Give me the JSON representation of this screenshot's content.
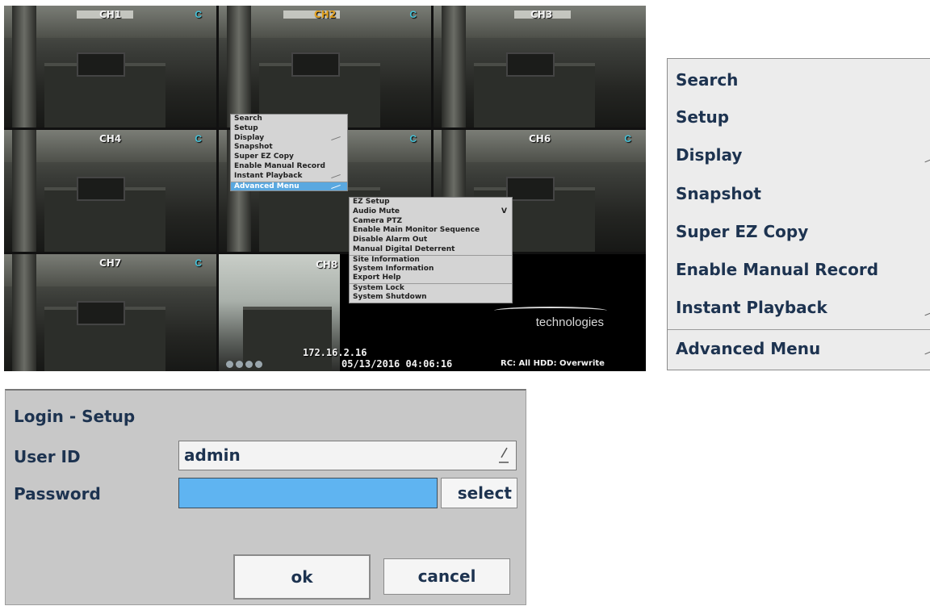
{
  "dvr": {
    "channels": [
      "CH1",
      "CH2",
      "CH3",
      "CH4",
      "",
      "CH6",
      "CH7",
      "CH8"
    ],
    "channel_badge": "C",
    "active_channel_color": "#e0a020",
    "ip": "172.16.2.16",
    "datetime": "05/13/2016 04:06:16",
    "status": "RC: All   HDD: Overwrite",
    "brand_text": "technologies",
    "menu": {
      "items": [
        "Search",
        "Setup",
        "Display",
        "Snapshot",
        "Super EZ Copy",
        "Enable Manual Record",
        "Instant Playback",
        "Advanced Menu"
      ],
      "highlighted": "Advanced Menu"
    },
    "submenu": {
      "items": [
        "EZ Setup",
        "Audio Mute",
        "Camera PTZ",
        "Enable Main Monitor Sequence",
        "Disable Alarm Out",
        "Manual Digital Deterrent",
        "Site Information",
        "System Information",
        "Export Help",
        "System Lock",
        "System Shutdown"
      ],
      "audio_mute_marker": "V"
    }
  },
  "zoomed_menu": {
    "items": [
      "Search",
      "Setup",
      "Display",
      "Snapshot",
      "Super EZ Copy",
      "Enable Manual Record",
      "Instant Playback",
      "Advanced Menu"
    ]
  },
  "login": {
    "title": "Login - Setup",
    "user_id_label": "User ID",
    "user_id_value": "admin",
    "password_label": "Password",
    "password_value": "",
    "select_label": "select",
    "ok_label": "ok",
    "cancel_label": "cancel",
    "password_field_color": "#5fb4f1"
  }
}
